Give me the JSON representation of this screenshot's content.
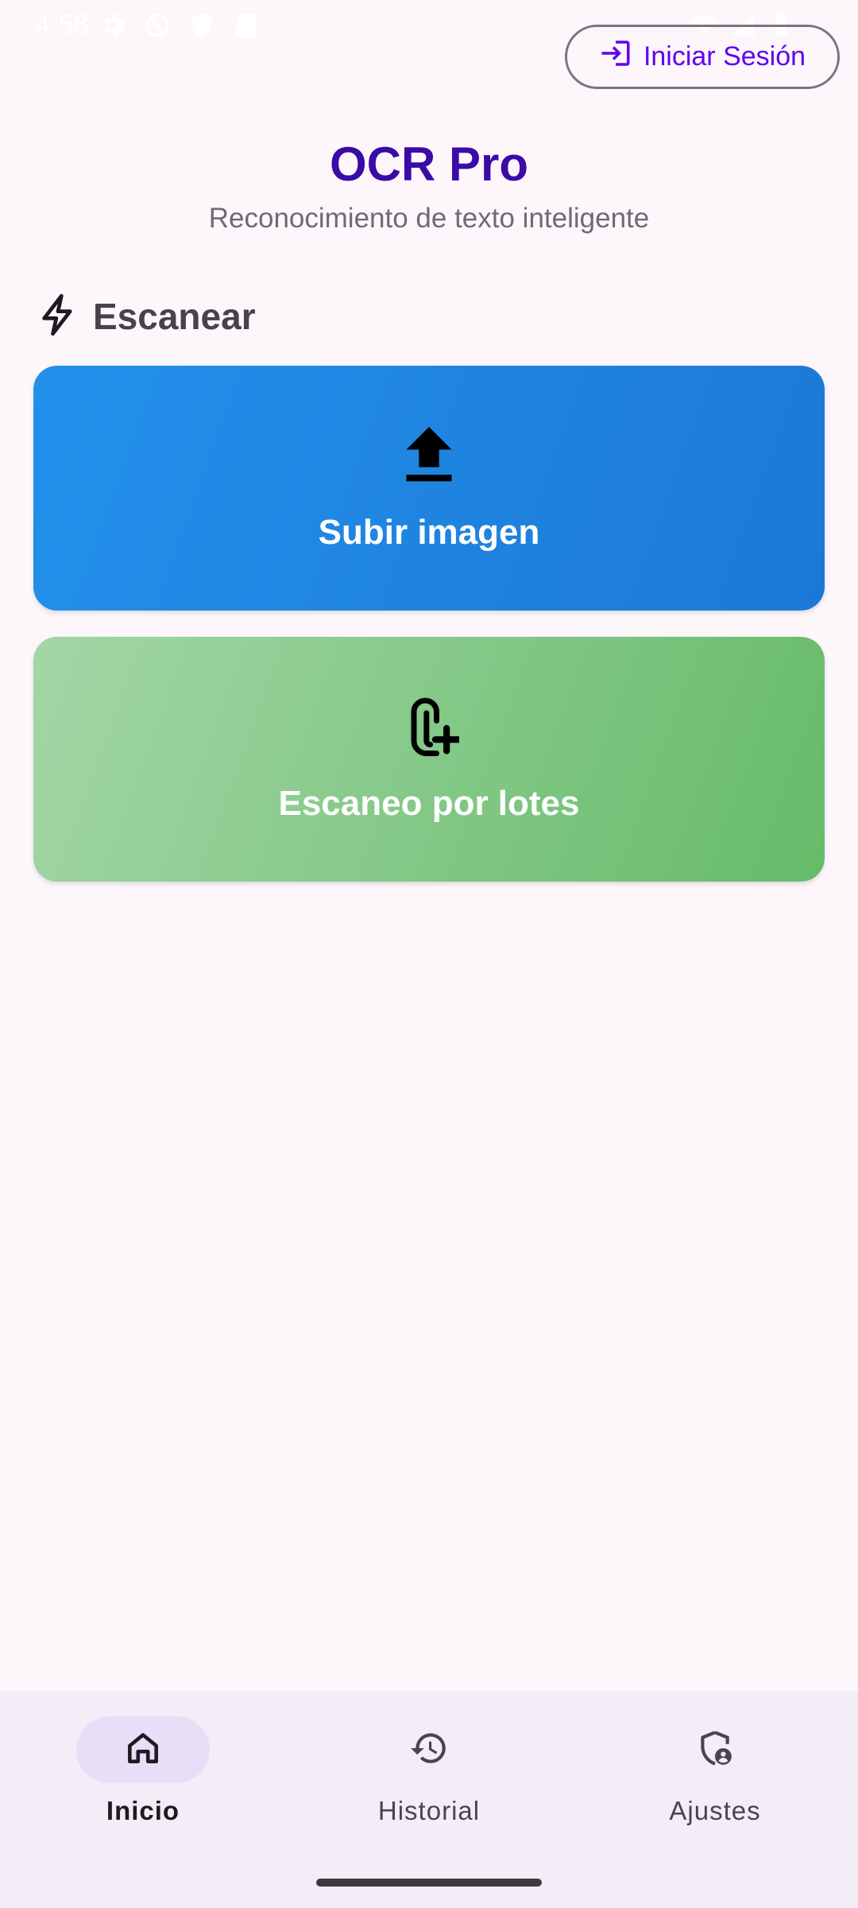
{
  "status_bar": {
    "time": "4:58"
  },
  "login": {
    "label": "Iniciar Sesión",
    "icon": "login-icon"
  },
  "header": {
    "title": "OCR Pro",
    "subtitle": "Reconocimiento de texto inteligente"
  },
  "scan_section": {
    "title": "Escanear",
    "icon": "bolt-icon"
  },
  "actions": [
    {
      "label": "Subir imagen",
      "icon": "upload-icon",
      "colors": [
        "#2291EB",
        "#1C78D6"
      ]
    },
    {
      "label": "Escaneo por lotes",
      "icon": "batch-attach-icon",
      "colors": [
        "#A3D6A6",
        "#66BB69"
      ]
    }
  ],
  "nav": {
    "items": [
      {
        "label": "Inicio",
        "icon": "home-icon",
        "active": true
      },
      {
        "label": "Historial",
        "icon": "history-icon",
        "active": false
      },
      {
        "label": "Ajustes",
        "icon": "admin-shield-icon",
        "active": false
      }
    ]
  },
  "colors": {
    "background": "#FDF7FC",
    "accent": "#6200EE",
    "title": "#3B0BA6",
    "nav_background": "#F3EDF7",
    "nav_active_pill": "#E8DEF8"
  }
}
